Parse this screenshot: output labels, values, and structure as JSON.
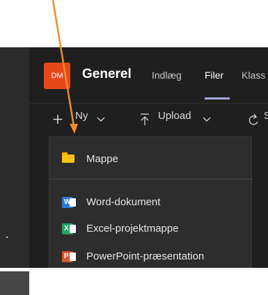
{
  "team": {
    "avatar": "DM",
    "title": "Generel",
    "tabs": [
      {
        "label": "Indlæg"
      },
      {
        "label": "Filer"
      },
      {
        "label": "Klass"
      }
    ]
  },
  "toolbar": {
    "new_label": "Ny",
    "upload_label": "Upload",
    "sync_partial": "S"
  },
  "dropdown": {
    "items": [
      {
        "label": "Mappe",
        "icon": "folder-icon"
      },
      {
        "label": "Word-dokument",
        "icon": "word-icon"
      },
      {
        "label": "Excel-projektmappe",
        "icon": "excel-icon"
      },
      {
        "label": "PowerPoint-præsentation",
        "icon": "powerpoint-icon"
      }
    ]
  },
  "colors": {
    "annotation_arrow": "#f28c28",
    "avatar_bg": "#e8471c",
    "tab_indicator": "#a6a7dc"
  }
}
